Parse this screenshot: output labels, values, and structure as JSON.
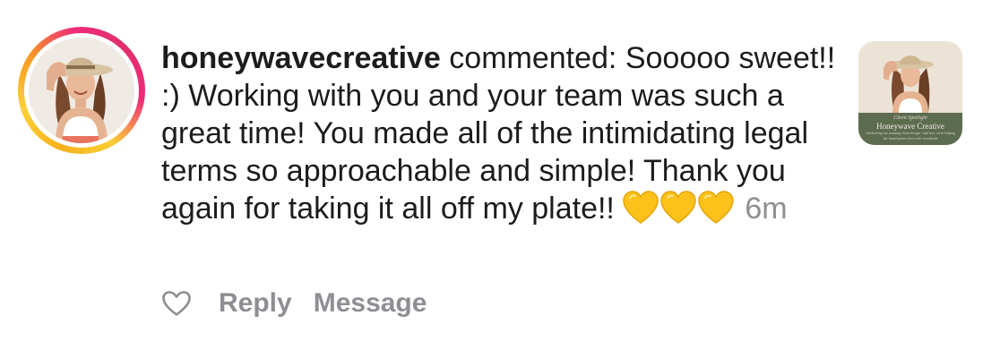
{
  "notification": {
    "username": "honeywavecreative",
    "comment_text": " commented: Sooooo sweet!! :) Working with you and your team was such a great time! You made all of the intimidating legal terms so approachable and simple! Thank you again for taking it all off my plate!! ",
    "emoji_icons": [
      "yellow-heart-icon",
      "yellow-heart-icon",
      "yellow-heart-icon"
    ],
    "timestamp": "6m"
  },
  "actions": {
    "like_icon": "heart-outline-icon",
    "reply_label": "Reply",
    "message_label": "Message"
  },
  "post_thumbnail": {
    "kicker": "Client Spotlight",
    "title": "Honeywave Creative",
    "subtitle": "Celebrating our amazing client design - and how we're helping her brand protect her work worldwide"
  },
  "colors": {
    "text": "#1c1c1e",
    "secondary_text": "#8e8e93",
    "story_ring_gradient": [
      "#f9ce34",
      "#ee2a7b",
      "#f59b23"
    ],
    "heart_emoji": "#fcc21b",
    "thumbnail_banner": "#5d6b4f"
  }
}
